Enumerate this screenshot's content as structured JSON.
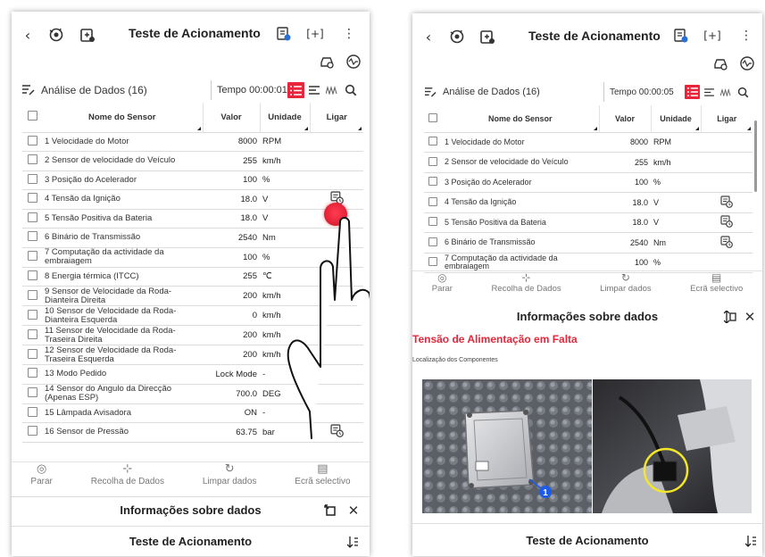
{
  "colors": {
    "accent": "#e8253a",
    "blue_marker": "#1e5be6",
    "yellow_circle": "#f2e52a"
  },
  "screenA": {
    "title": "Teste de Acionamento",
    "analysis_title": "Análise de Dados (16)",
    "time": "Tempo 00:00:01",
    "headers": {
      "name": "Nome do Sensor",
      "value": "Valor",
      "unit": "Unidade",
      "action": "Ligar"
    },
    "rows": [
      {
        "name": "1 Velocidade do Motor",
        "value": "8000",
        "unit": "RPM",
        "icon": ""
      },
      {
        "name": "2 Sensor de velocidade do Veículo",
        "value": "255",
        "unit": "km/h",
        "icon": ""
      },
      {
        "name": "3 Posição do Acelerador",
        "value": "100",
        "unit": "%",
        "icon": ""
      },
      {
        "name": "4 Tensão da Ignição",
        "value": "18.0",
        "unit": "V",
        "icon": "activate-icon"
      },
      {
        "name": "5 Tensão Positiva da Bateria",
        "value": "18.0",
        "unit": "V",
        "icon": ""
      },
      {
        "name": "6 Binário de Transmissão",
        "value": "2540",
        "unit": "Nm",
        "icon": ""
      },
      {
        "name": "7 Computação da actividade da embraiagem",
        "value": "100",
        "unit": "%",
        "icon": ""
      },
      {
        "name": "8 Energia térmica (ITCC)",
        "value": "255",
        "unit": "℃",
        "icon": ""
      },
      {
        "name": "9 Sensor de Velocidade da Roda-Dianteira Direita",
        "value": "200",
        "unit": "km/h",
        "icon": ""
      },
      {
        "name": "10 Sensor de Velocidade da Roda-Dianteira Esquerda",
        "value": "0",
        "unit": "km/h",
        "icon": ""
      },
      {
        "name": "11 Sensor de Velocidade da Roda-Traseira Direita",
        "value": "200",
        "unit": "km/h",
        "icon": ""
      },
      {
        "name": "12 Sensor de Velocidade da Roda-Traseira Esquerda",
        "value": "200",
        "unit": "km/h",
        "icon": ""
      },
      {
        "name": "13 Modo Pedido",
        "value": "Lock Mode",
        "unit": "-",
        "icon": ""
      },
      {
        "name": "14 Sensor do Ângulo da Direcção (Apenas ESP)",
        "value": "700.0",
        "unit": "DEG",
        "icon": ""
      },
      {
        "name": "15 Lâmpada Avisadora",
        "value": "ON",
        "unit": "-",
        "icon": ""
      },
      {
        "name": "16 Sensor de Pressão",
        "value": "63.75",
        "unit": "bar",
        "icon": "activate-icon"
      }
    ],
    "bottom": [
      {
        "label": "Parar",
        "icon": "stop-icon",
        "glyph": "◎"
      },
      {
        "label": "Recolha de Dados",
        "icon": "collect-icon",
        "glyph": "⊹"
      },
      {
        "label": "Limpar dados",
        "icon": "refresh-icon",
        "glyph": "↻"
      },
      {
        "label": "Ecrã selectivo",
        "icon": "select-screen-icon",
        "glyph": "▤"
      }
    ],
    "info_title": "Informações sobre dados",
    "footer_title": "Teste de Acionamento"
  },
  "screenB": {
    "title": "Teste de Acionamento",
    "analysis_title": "Análise de Dados (16)",
    "time": "Tempo 00:00:05",
    "headers": {
      "name": "Nome do Sensor",
      "value": "Valor",
      "unit": "Unidade",
      "action": "Ligar"
    },
    "rows": [
      {
        "name": "1 Velocidade do Motor",
        "value": "8000",
        "unit": "RPM",
        "icon": ""
      },
      {
        "name": "2 Sensor de velocidade do Veículo",
        "value": "255",
        "unit": "km/h",
        "icon": ""
      },
      {
        "name": "3 Posição do Acelerador",
        "value": "100",
        "unit": "%",
        "icon": ""
      },
      {
        "name": "4 Tensão da Ignição",
        "value": "18.0",
        "unit": "V",
        "icon": "activate-icon"
      },
      {
        "name": "5 Tensão Positiva da Bateria",
        "value": "18.0",
        "unit": "V",
        "icon": "activate-icon"
      },
      {
        "name": "6 Binário de Transmissão",
        "value": "2540",
        "unit": "Nm",
        "icon": "activate-icon"
      },
      {
        "name": "7 Computação da actividade da embraiagem",
        "value": "100",
        "unit": "%",
        "icon": ""
      }
    ],
    "bottom": [
      {
        "label": "Parar",
        "icon": "stop-icon",
        "glyph": "◎"
      },
      {
        "label": "Recolha de Dados",
        "icon": "collect-icon",
        "glyph": "⊹"
      },
      {
        "label": "Limpar dados",
        "icon": "refresh-icon",
        "glyph": "↻"
      },
      {
        "label": "Ecrã selectivo",
        "icon": "select-screen-icon",
        "glyph": "▤"
      }
    ],
    "info_title": "Informações sobre dados",
    "info_heading": "Tensão de Alimentação em Falta",
    "info_subheading": "Localização dos Componentes",
    "marker_number": "1",
    "footer_title": "Teste de Acionamento"
  }
}
